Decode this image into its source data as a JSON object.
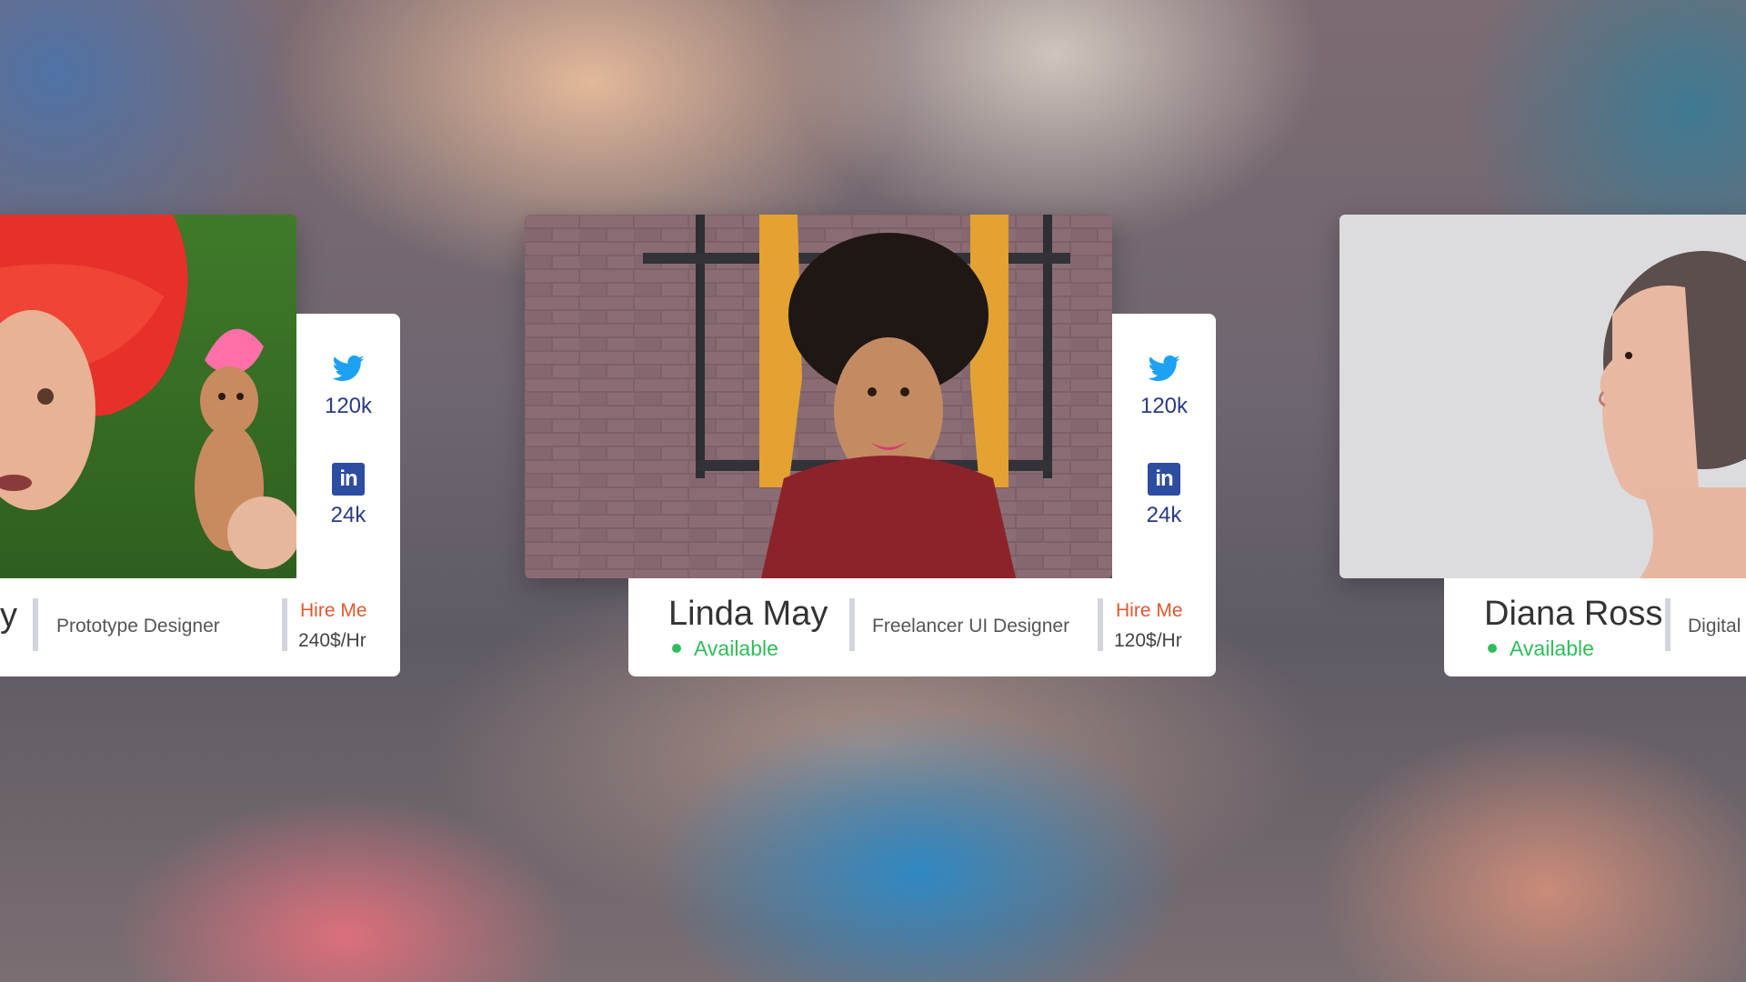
{
  "cards": [
    {
      "name": "y",
      "role": "Prototype Designer",
      "hire_label": "Hire Me",
      "rate": "240$/Hr",
      "twitter_count": "120k",
      "linkedin_count": "24k",
      "photo": "portrait-red-hair-with-troll-doll"
    },
    {
      "name": "Linda May",
      "status": "Available",
      "role": "Freelancer UI Designer",
      "hire_label": "Hire Me",
      "rate": "120$/Hr",
      "twitter_count": "120k",
      "linkedin_count": "24k",
      "photo": "portrait-curly-hair-red-scarf"
    },
    {
      "name": "Diana Ross",
      "status": "Available",
      "role": "Digital",
      "photo": "portrait-profile-gray-background"
    }
  ],
  "icons": {
    "twitter": "twitter-icon",
    "linkedin": "linkedin-icon",
    "status": "status-dot-icon"
  },
  "colors": {
    "twitter": "#1da1f2",
    "linkedin": "#2d4da1",
    "counts": "#2b3a85",
    "available": "#2fbd5b",
    "hire": "#e0582d",
    "separator": "#d2d5dc",
    "card_bg": "#ffffff"
  }
}
